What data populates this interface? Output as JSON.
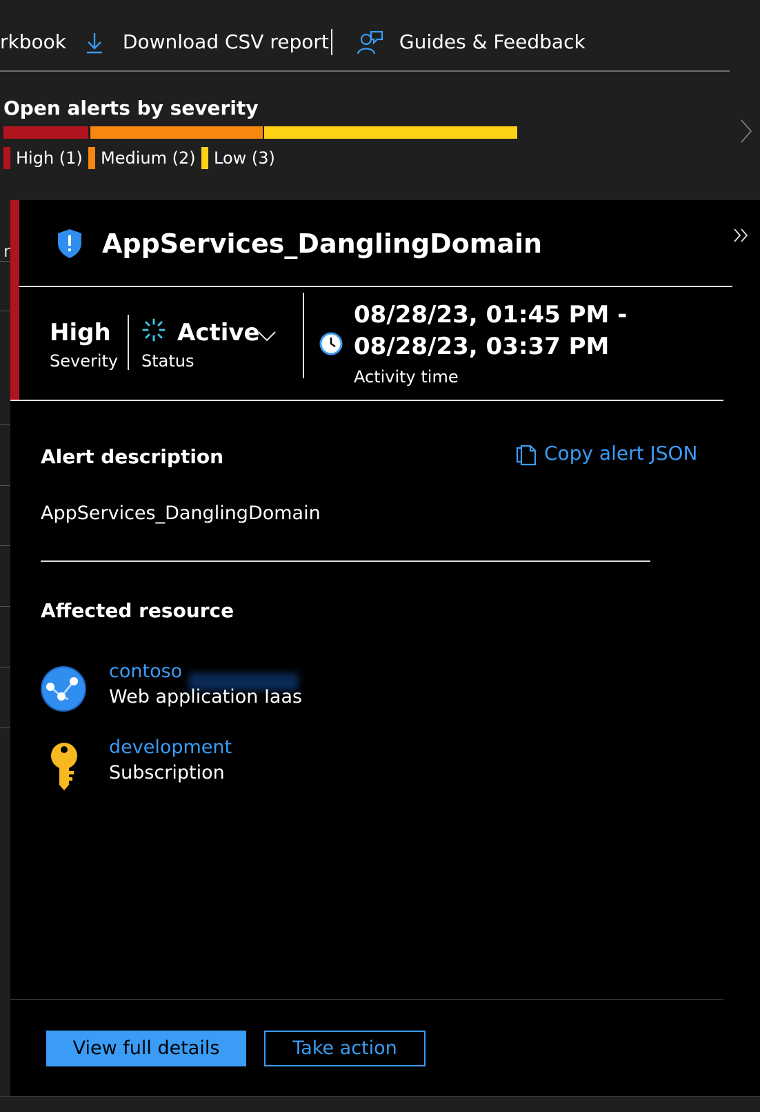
{
  "toolbar": {
    "workbook_label": "rkbook",
    "download_label": "Download CSV report",
    "guides_label": "Guides & Feedback"
  },
  "severity_summary": {
    "title": "Open alerts by severity",
    "segments": [
      {
        "label": "High (1)",
        "count": 1,
        "color": "#b0141e"
      },
      {
        "label": "Medium (2)",
        "count": 2,
        "color": "#f7870f"
      },
      {
        "label": "Low (3)",
        "count": 3,
        "color": "#fcd116"
      }
    ]
  },
  "alert": {
    "title": "AppServices_DanglingDomain",
    "severity_value": "High",
    "severity_label": "Severity",
    "status_value": "Active",
    "status_label": "Status",
    "time_start": "08/28/23, 01:45 PM -",
    "time_end": "08/28/23, 03:37 PM",
    "time_label": "Activity time",
    "accent_color": "#b0141e"
  },
  "description": {
    "heading": "Alert description",
    "copy_label": "Copy alert JSON",
    "text": "AppServices_DanglingDomain"
  },
  "affected": {
    "heading": "Affected resource",
    "resources": [
      {
        "name": "contoso",
        "type": "Web application Iaas",
        "icon": "web-app-icon"
      },
      {
        "name": "development",
        "type": "Subscription",
        "icon": "key-icon"
      }
    ]
  },
  "actions": {
    "view_details": "View full details",
    "take_action": "Take action"
  },
  "colors": {
    "link": "#3a9cf5",
    "panel_bg": "#000000",
    "page_bg": "#1f1f1f"
  }
}
